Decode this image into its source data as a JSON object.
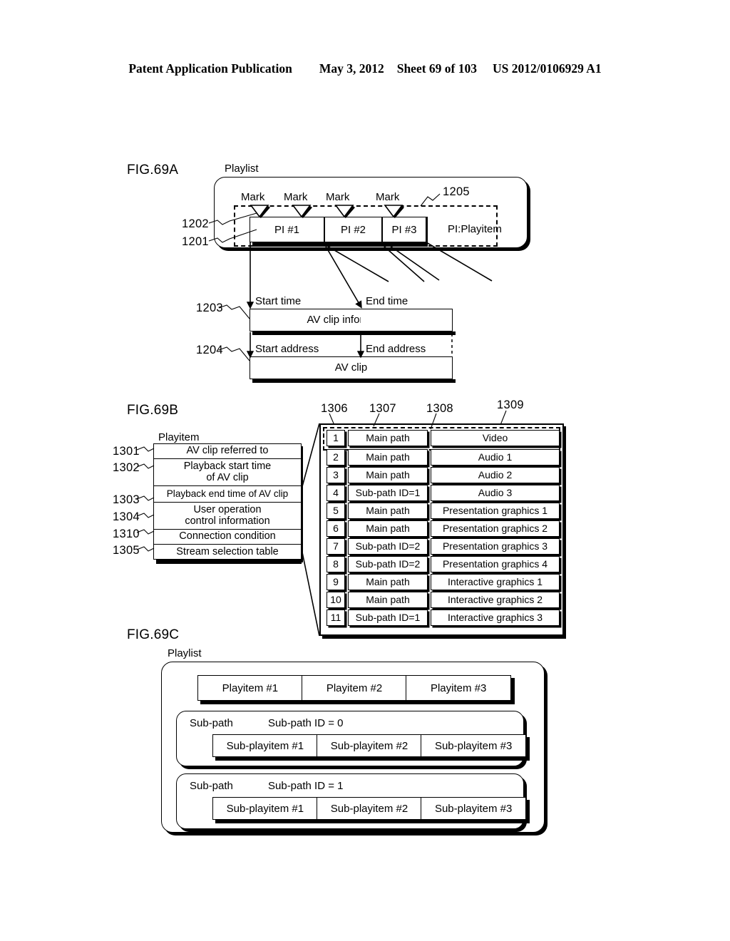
{
  "header": {
    "publication": "Patent Application Publication",
    "date": "May 3, 2012",
    "sheet": "Sheet 69 of 103",
    "docnumber": "US 2012/0106929 A1"
  },
  "fig69a": {
    "label": "FIG.69A",
    "playlist_caption": "Playlist",
    "marks": [
      "Mark",
      "Mark",
      "Mark",
      "Mark"
    ],
    "playitems": [
      "PI #1",
      "PI #2",
      "PI #3"
    ],
    "legend": "PI:Playitem",
    "refs": {
      "r1205": "1205",
      "r1202": "1202",
      "r1201": "1201",
      "r1203": "1203",
      "r1204": "1204"
    },
    "start_time_label": "Start time",
    "end_time_label": "End time",
    "av_clip_information": "AV clip information",
    "start_address_label": "Start address",
    "end_address_label": "End address",
    "av_clip": "AV clip"
  },
  "fig69b": {
    "label": "FIG.69B",
    "playitem_caption": "Playitem",
    "playitem_fields": [
      {
        "ref": "1301",
        "text": "AV clip referred to"
      },
      {
        "ref": "1302",
        "text": "Playback start time\nof AV clip"
      },
      {
        "ref": "1303",
        "text": "Playback end time of AV clip"
      },
      {
        "ref": "1304",
        "text": "User operation\ncontrol information"
      },
      {
        "ref": "1310",
        "text": "Connection condition"
      },
      {
        "ref": "1305",
        "text": "Stream selection table"
      }
    ],
    "column_refs": [
      "1306",
      "1307",
      "1308",
      "1309"
    ],
    "stream_table": [
      {
        "num": "1",
        "path": "Main path",
        "stream": "Video"
      },
      {
        "num": "2",
        "path": "Main path",
        "stream": "Audio 1"
      },
      {
        "num": "3",
        "path": "Main path",
        "stream": "Audio 2"
      },
      {
        "num": "4",
        "path": "Sub-path ID=1",
        "stream": "Audio 3"
      },
      {
        "num": "5",
        "path": "Main path",
        "stream": "Presentation graphics 1"
      },
      {
        "num": "6",
        "path": "Main path",
        "stream": "Presentation graphics 2"
      },
      {
        "num": "7",
        "path": "Sub-path ID=2",
        "stream": "Presentation graphics 3"
      },
      {
        "num": "8",
        "path": "Sub-path ID=2",
        "stream": "Presentation graphics 4"
      },
      {
        "num": "9",
        "path": "Main path",
        "stream": "Interactive graphics 1"
      },
      {
        "num": "10",
        "path": "Main path",
        "stream": "Interactive graphics 2"
      },
      {
        "num": "11",
        "path": "Sub-path ID=1",
        "stream": "Interactive graphics 3"
      }
    ]
  },
  "fig69c": {
    "label": "FIG.69C",
    "playlist_caption": "Playlist",
    "playitems": [
      "Playitem #1",
      "Playitem #2",
      "Playitem #3"
    ],
    "subpaths": [
      {
        "title": "Sub-path",
        "id_label": "Sub-path ID = 0",
        "items": [
          "Sub-playitem #1",
          "Sub-playitem #2",
          "Sub-playitem #3"
        ]
      },
      {
        "title": "Sub-path",
        "id_label": "Sub-path ID = 1",
        "items": [
          "Sub-playitem #1",
          "Sub-playitem #2",
          "Sub-playitem #3"
        ]
      }
    ]
  }
}
